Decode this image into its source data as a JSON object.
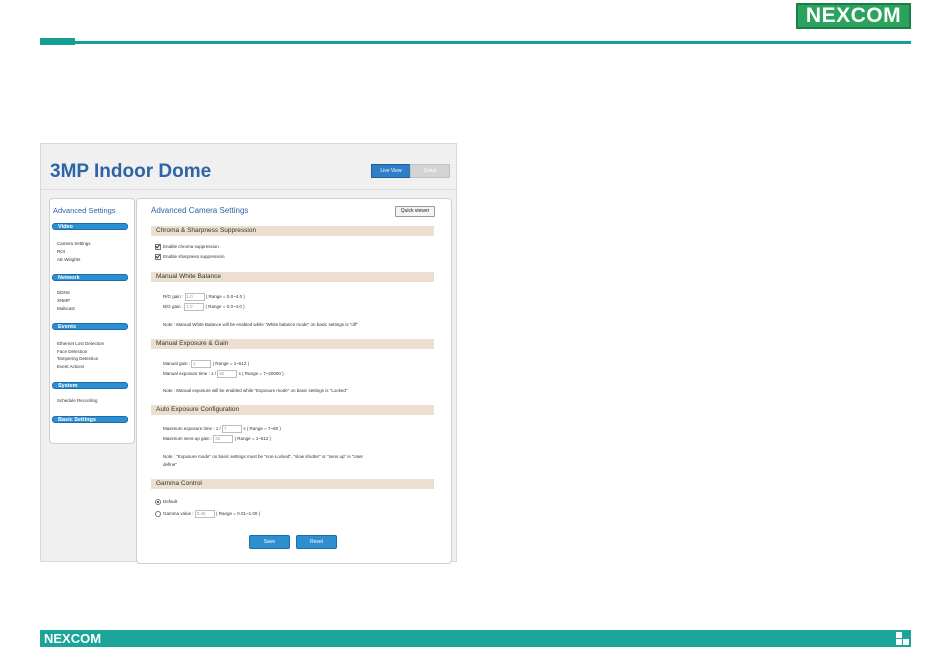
{
  "slide": {
    "brand": "NEXCOM",
    "footer_brand": "NEXCOM"
  },
  "ui": {
    "title": "3MP Indoor Dome",
    "header_buttons": {
      "live_view": "Live View",
      "setup": "Setup"
    },
    "sidebar": {
      "title": "Advanced Settings",
      "categories": [
        {
          "label": "Video",
          "items": [
            "Camera Settings",
            "ROI",
            "AE Weights"
          ]
        },
        {
          "label": "Network",
          "items": [
            "DDNS",
            "SNMP",
            "Multicast"
          ]
        },
        {
          "label": "Events",
          "items": [
            "Ethernet Lost Detection",
            "Face Detection",
            "Tampering Detection",
            "Event Actions"
          ]
        },
        {
          "label": "System",
          "items": [
            "Schedule Recording"
          ]
        },
        {
          "label": "Basic Settings",
          "items": []
        }
      ]
    },
    "main": {
      "title": "Advanced Camera Settings",
      "quick_viewer": "Quick viewer",
      "chroma": {
        "heading": "Chroma & Sharpness Suppression",
        "enable_chroma": "Enable chroma suppression",
        "enable_sharpness": "Enable sharpness suppression"
      },
      "white_balance": {
        "heading": "Manual White Balance",
        "rg_label": "R/G gain :",
        "rg_value": "1.0",
        "rg_range": "( Range = 0.0~4.0 )",
        "bg_label": "B/G gain :",
        "bg_value": "1.0",
        "bg_range": "( Range = 0.0~4.0 )",
        "note": "Note : Manual White Balance will be enabled while \"White balance mode\" on basic settings is \"off\""
      },
      "exposure_gain": {
        "heading": "Manual Exposure & Gain",
        "gain_label": "Manual gain :",
        "gain_value": "1",
        "gain_range": "( Range = 1~512 )",
        "exp_label": "Manual exposure time : 1 /",
        "exp_value": "60",
        "exp_range": "s ( Range = 7~20000 )",
        "note": "Note : Manual exposure will be enabled while \"Exposure mode\" on basic settings is \"Locked\""
      },
      "auto_exposure": {
        "heading": "Auto Exposure Configuration",
        "max_exp_label": "Maximum exposure time : 1 /",
        "max_exp_value": "7",
        "max_exp_range": "s ( Range = 7~60 )",
        "max_sens_label": "Maximum sens-up gain :",
        "max_sens_value": "32",
        "max_sens_range": "( Range = 1~512 )",
        "note_line1": "Note : \"Exposure mode\" on basic settings must be \"non-Locked\", \"slow shutter\" or \"sens up\" is \"User",
        "note_line2": "define\""
      },
      "gamma": {
        "heading": "Gamma Control",
        "default_label": "Default",
        "gamma_label": "Gamma value :",
        "gamma_value": "0.45",
        "gamma_range": "( Range = 0.01~1.00 )"
      },
      "save": "Save",
      "reset": "Reset"
    }
  }
}
